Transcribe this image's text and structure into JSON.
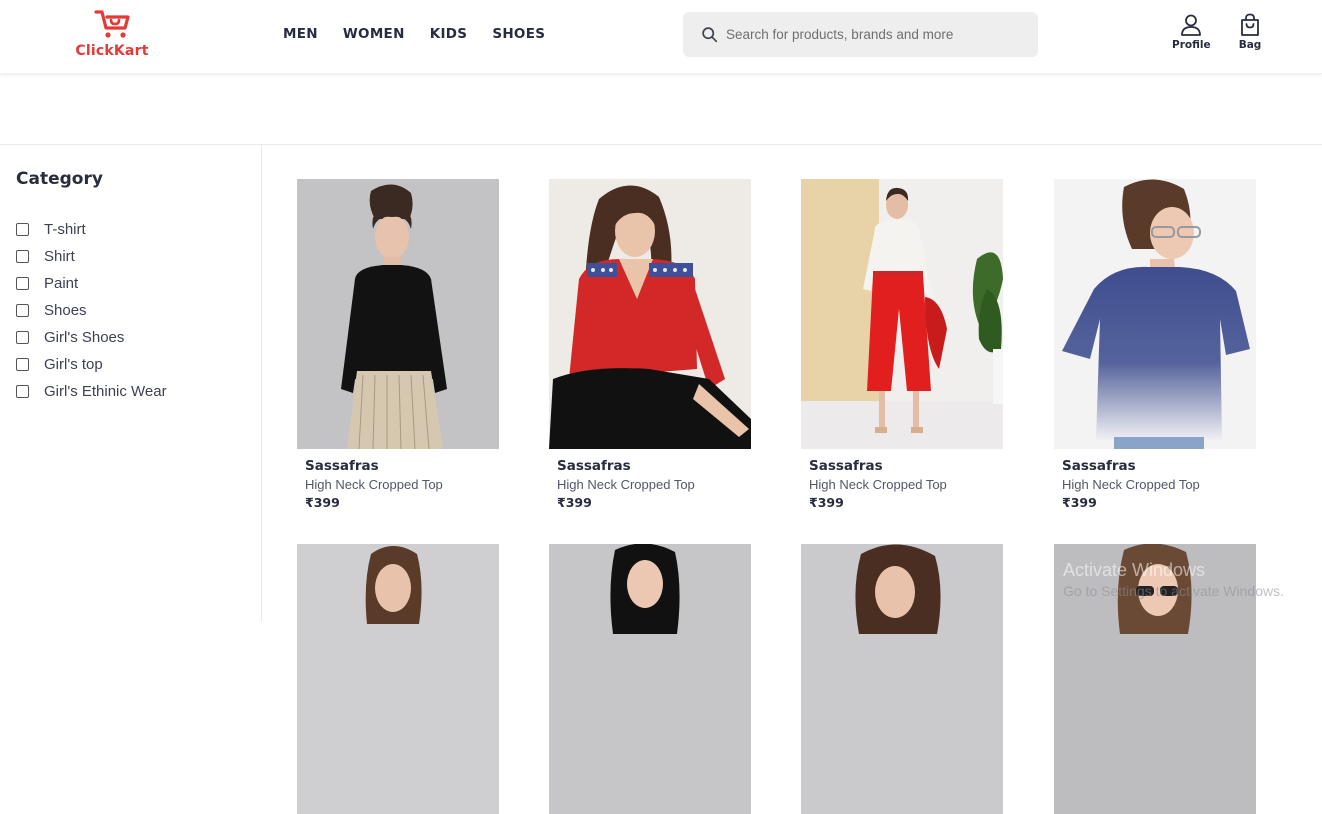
{
  "brand": {
    "name": "ClickKart",
    "color": "#e53935"
  },
  "nav": {
    "items": [
      "MEN",
      "WOMEN",
      "KIDS",
      "SHOES"
    ]
  },
  "search": {
    "placeholder": "Search for products, brands and more",
    "icon": "search-icon"
  },
  "header_actions": {
    "profile_label": "Profile",
    "bag_label": "Bag"
  },
  "sidebar": {
    "title": "Category",
    "items": [
      "T-shirt",
      "Shirt",
      "Paint",
      "Shoes",
      "Girl's Shoes",
      "Girl's top",
      "Girl's Ethinic Wear"
    ]
  },
  "products": [
    {
      "brand": "Sassafras",
      "name": "High Neck Cropped Top",
      "price": "₹399"
    },
    {
      "brand": "Sassafras",
      "name": "High Neck Cropped Top",
      "price": "₹399"
    },
    {
      "brand": "Sassafras",
      "name": "High Neck Cropped Top",
      "price": "₹399"
    },
    {
      "brand": "Sassafras",
      "name": "High Neck Cropped Top",
      "price": "₹399"
    }
  ],
  "watermark": {
    "line1": "Activate Windows",
    "line2": "Go to Settings to activate Windows."
  }
}
